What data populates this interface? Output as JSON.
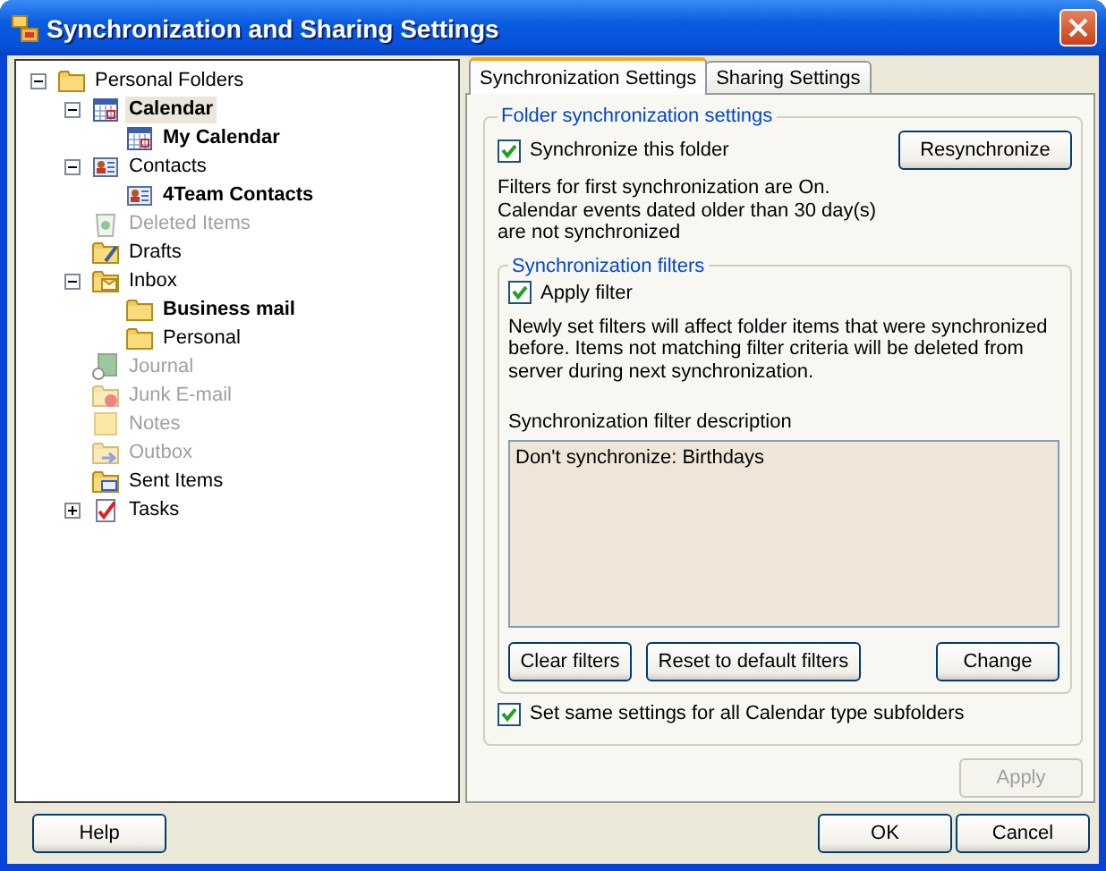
{
  "window": {
    "title": "Synchronization and Sharing Settings"
  },
  "tree": [
    {
      "label": "Personal Folders",
      "kind": "folder",
      "bold": false,
      "disabled": false,
      "selected": false,
      "expanded": true,
      "children": [
        {
          "label": "Calendar",
          "kind": "calendar",
          "bold": true,
          "disabled": false,
          "selected": true,
          "expanded": true,
          "children": [
            {
              "label": "My Calendar",
              "kind": "calendar",
              "bold": true,
              "disabled": false,
              "selected": false
            }
          ]
        },
        {
          "label": "Contacts",
          "kind": "contacts",
          "bold": false,
          "disabled": false,
          "selected": false,
          "expanded": true,
          "children": [
            {
              "label": "4Team Contacts",
              "kind": "contacts",
              "bold": true,
              "disabled": false,
              "selected": false
            }
          ]
        },
        {
          "label": "Deleted Items",
          "kind": "trash",
          "bold": false,
          "disabled": true,
          "selected": false
        },
        {
          "label": "Drafts",
          "kind": "drafts",
          "bold": false,
          "disabled": false,
          "selected": false
        },
        {
          "label": "Inbox",
          "kind": "inbox",
          "bold": false,
          "disabled": false,
          "selected": false,
          "expanded": true,
          "children": [
            {
              "label": "Business mail",
              "kind": "folder",
              "bold": true,
              "disabled": false,
              "selected": false
            },
            {
              "label": "Personal",
              "kind": "folder",
              "bold": false,
              "disabled": false,
              "selected": false
            }
          ]
        },
        {
          "label": "Journal",
          "kind": "journal",
          "bold": false,
          "disabled": true,
          "selected": false
        },
        {
          "label": "Junk E-mail",
          "kind": "junk",
          "bold": false,
          "disabled": true,
          "selected": false
        },
        {
          "label": "Notes",
          "kind": "notes",
          "bold": false,
          "disabled": true,
          "selected": false
        },
        {
          "label": "Outbox",
          "kind": "outbox",
          "bold": false,
          "disabled": true,
          "selected": false
        },
        {
          "label": "Sent Items",
          "kind": "sent",
          "bold": false,
          "disabled": false,
          "selected": false
        },
        {
          "label": "Tasks",
          "kind": "tasks",
          "bold": false,
          "disabled": false,
          "selected": false,
          "expanded": false
        }
      ]
    }
  ],
  "tabs": [
    {
      "label": "Synchronization Settings",
      "selected": true
    },
    {
      "label": "Sharing Settings",
      "selected": false
    }
  ],
  "folder_group": {
    "title": "Folder synchronization settings",
    "sync_checkbox": {
      "label": "Synchronize this folder",
      "checked": true
    },
    "resync_button": "Resynchronize",
    "info_lines": [
      "Filters for first synchronization are On.",
      "Calendar events dated older than 30 day(s)",
      "are not synchronized"
    ],
    "filter_group": {
      "title": "Synchronization filters",
      "apply_checkbox": {
        "label": "Apply filter",
        "checked": true
      },
      "note": "Newly set filters will affect folder items that were synchronized before. Items not matching filter criteria will be deleted from server during next synchronization.",
      "description_label": "Synchronization filter description",
      "description": "Don't synchronize: Birthdays",
      "buttons": [
        "Clear filters",
        "Reset to default filters",
        "Change"
      ]
    },
    "subfolders_checkbox": {
      "label": "Set same settings for all Calendar type subfolders",
      "checked": true
    }
  },
  "apply_button": {
    "label": "Apply",
    "disabled": true
  },
  "footer_buttons": [
    {
      "label": "Help"
    },
    {
      "label": "OK"
    },
    {
      "label": "Cancel"
    }
  ]
}
